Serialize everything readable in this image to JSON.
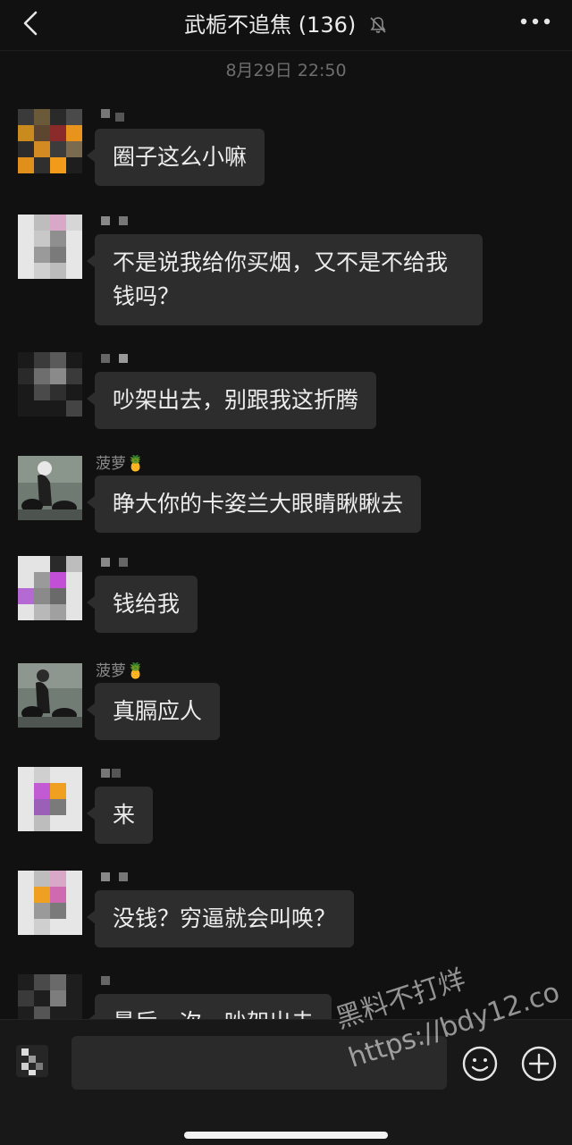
{
  "header": {
    "title": "武栀不追焦 (136)",
    "back_icon": "chevron-left-icon",
    "mute_icon": "bell-off-icon",
    "more_icon": "more-horizontal-icon"
  },
  "timestamp": "8月29日 22:50",
  "messages": [
    {
      "sender": "",
      "text": "圈子这么小嘛"
    },
    {
      "sender": "",
      "text": "不是说我给你买烟，又不是不给我钱吗？"
    },
    {
      "sender": "",
      "text": "吵架出去，别跟我这折腾"
    },
    {
      "sender": "菠萝🍍",
      "text": "睁大你的卡姿兰大眼睛瞅瞅去"
    },
    {
      "sender": "",
      "text": "钱给我"
    },
    {
      "sender": "菠萝🍍",
      "text": "真膈应人"
    },
    {
      "sender": "",
      "text": "来"
    },
    {
      "sender": "",
      "text": "没钱？穷逼就会叫唤？"
    },
    {
      "sender": "",
      "text": "最后一次，吵架出去"
    }
  ],
  "composer": {
    "input_value": "",
    "voice_icon": "voice-icon",
    "emoji_icon": "emoji-icon",
    "plus_icon": "plus-circle-icon"
  },
  "watermark": {
    "line1": "黑料不打烊",
    "line2": "https://bdy12.co"
  },
  "colors": {
    "background": "#111111",
    "bubble": "#2d2d2d",
    "text": "#ededed",
    "muted_text": "#8a8a8a"
  }
}
